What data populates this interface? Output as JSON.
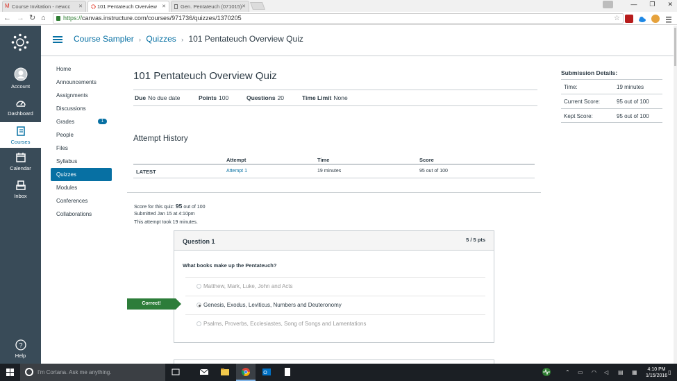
{
  "browser": {
    "tabs": [
      {
        "title": "Course Invitation - newcc",
        "active": false
      },
      {
        "title": "101 Pentateuch Overview",
        "active": true
      },
      {
        "title": "Gen. Pentateuch (071015)",
        "active": false
      }
    ],
    "url_scheme": "https://",
    "url_rest": "canvas.instructure.com/courses/971736/quizzes/1370205"
  },
  "global_nav": {
    "items": [
      {
        "label": "Account"
      },
      {
        "label": "Dashboard"
      },
      {
        "label": "Courses"
      },
      {
        "label": "Calendar"
      },
      {
        "label": "Inbox"
      },
      {
        "label": "Help"
      }
    ]
  },
  "breadcrumb": {
    "course": "Course Sampler",
    "section": "Quizzes",
    "current": "101 Pentateuch Overview Quiz",
    "separator": "›"
  },
  "course_nav": {
    "items": [
      {
        "label": "Home"
      },
      {
        "label": "Announcements"
      },
      {
        "label": "Assignments"
      },
      {
        "label": "Discussions"
      },
      {
        "label": "Grades",
        "badge": "1"
      },
      {
        "label": "People"
      },
      {
        "label": "Files"
      },
      {
        "label": "Syllabus"
      },
      {
        "label": "Quizzes",
        "active": true
      },
      {
        "label": "Modules"
      },
      {
        "label": "Conferences"
      },
      {
        "label": "Collaborations"
      }
    ]
  },
  "quiz": {
    "title": "101 Pentateuch Overview Quiz",
    "due_label": "Due",
    "due_value": "No due date",
    "points_label": "Points",
    "points_value": "100",
    "questions_label": "Questions",
    "questions_value": "20",
    "time_limit_label": "Time Limit",
    "time_limit_value": "None"
  },
  "attempt_history": {
    "title": "Attempt History",
    "headers": {
      "attempt": "Attempt",
      "time": "Time",
      "score": "Score"
    },
    "row": {
      "label": "LATEST",
      "attempt": "Attempt 1",
      "time": "19 minutes",
      "score": "95 out of 100"
    }
  },
  "score_summary": {
    "prefix": "Score for this quiz:",
    "score": "95",
    "suffix": "out of 100",
    "submitted": "Submitted Jan 15 at 4:10pm",
    "duration": "This attempt took 19 minutes."
  },
  "question": {
    "number": "Question 1",
    "points": "5 / 5 pts",
    "text": "What books make up the Pentateuch?",
    "correct_label": "Correct!",
    "answers": [
      {
        "text": "Matthew, Mark, Luke, John and Acts",
        "selected": false
      },
      {
        "text": "Genesis, Exodus, Leviticus, Numbers and Deuteronomy",
        "selected": true
      },
      {
        "text": "Psalms, Proverbs, Ecclesiastes, Song of Songs and Lamentations",
        "selected": false
      }
    ]
  },
  "submission_details": {
    "title": "Submission Details:",
    "rows": [
      {
        "label": "Time:",
        "value": "19 minutes"
      },
      {
        "label": "Current Score:",
        "value": "95 out of 100"
      },
      {
        "label": "Kept Score:",
        "value": "95 out of 100"
      }
    ]
  },
  "taskbar": {
    "search_placeholder": "I'm Cortana. Ask me anything.",
    "time": "4:10 PM",
    "date": "1/15/2016"
  },
  "colors": {
    "brand_blue": "#0770a3",
    "nav_bg": "#394b58",
    "correct_green": "#2d7d3a"
  }
}
